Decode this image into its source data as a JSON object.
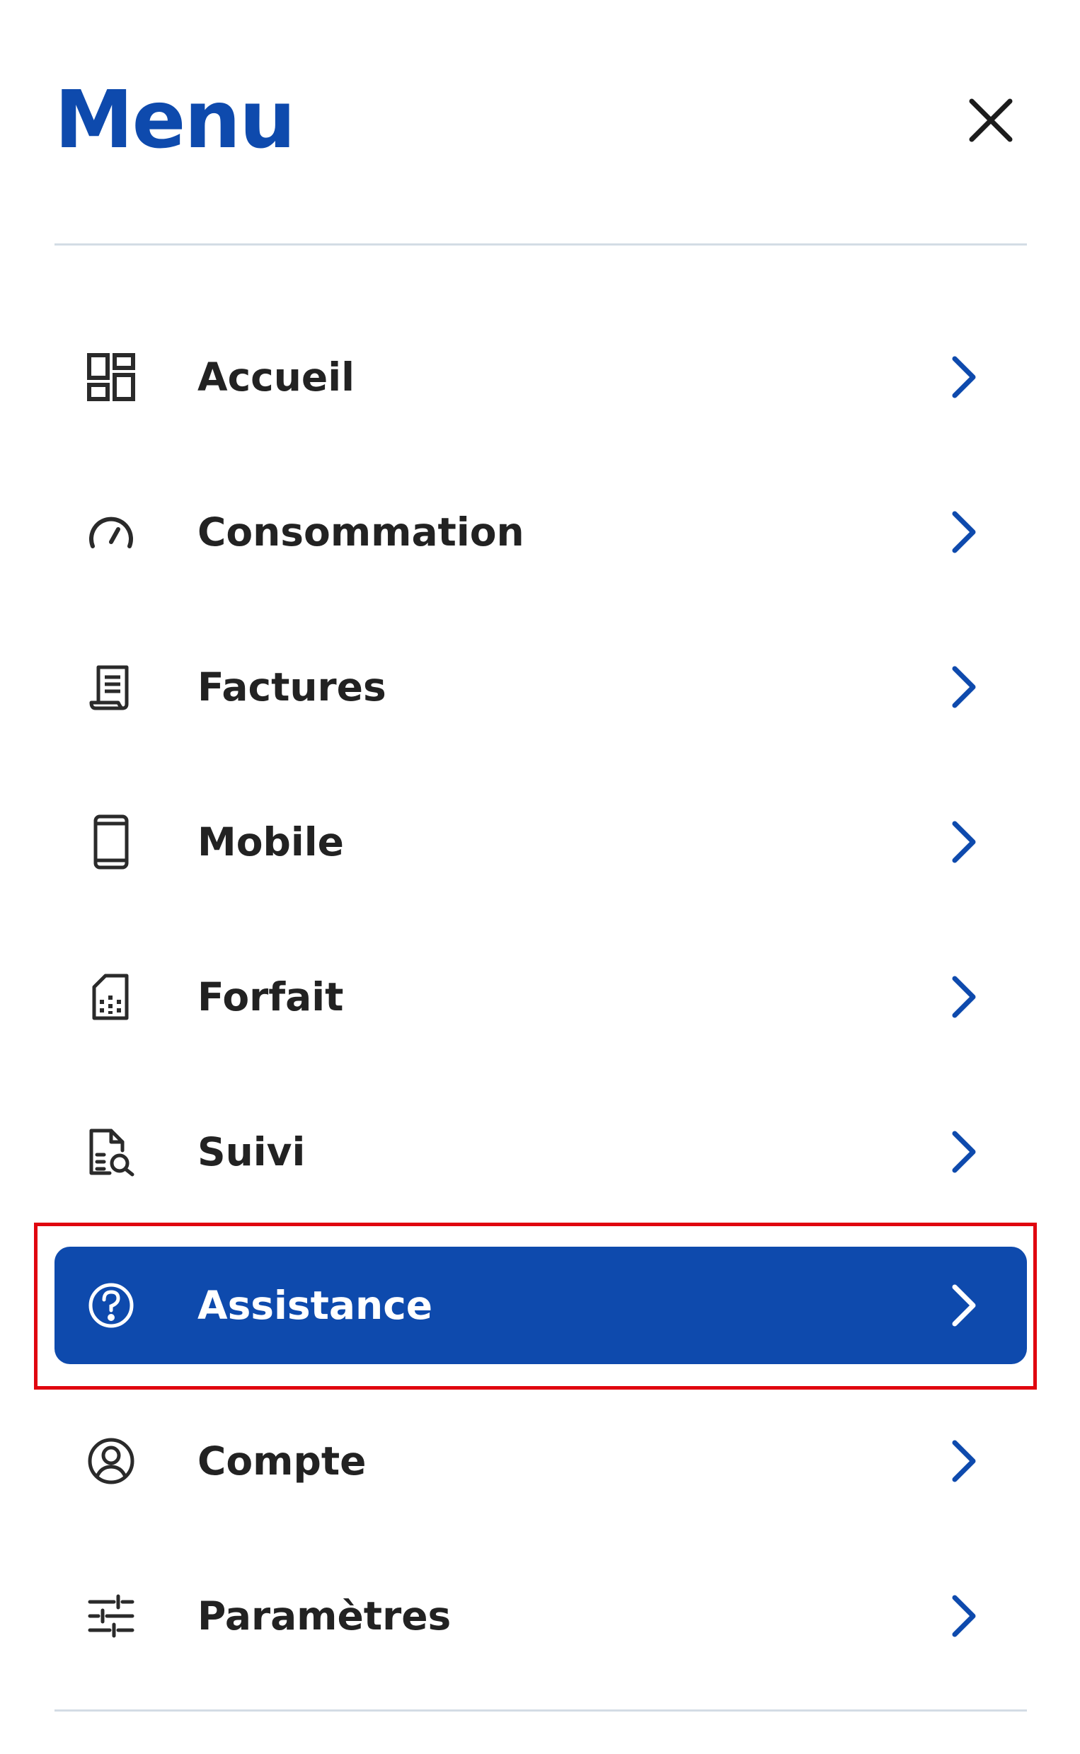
{
  "header": {
    "title": "Menu",
    "close_icon": "close-icon"
  },
  "menu": {
    "items": [
      {
        "label": "Accueil",
        "icon": "dashboard-icon"
      },
      {
        "label": "Consommation",
        "icon": "gauge-icon"
      },
      {
        "label": "Factures",
        "icon": "receipt-icon"
      },
      {
        "label": "Mobile",
        "icon": "smartphone-icon"
      },
      {
        "label": "Forfait",
        "icon": "sim-card-icon"
      },
      {
        "label": "Suivi",
        "icon": "document-search-icon"
      },
      {
        "label": "Assistance",
        "icon": "help-circle-icon",
        "active": true
      },
      {
        "label": "Compte",
        "icon": "account-circle-icon"
      },
      {
        "label": "Paramètres",
        "icon": "sliders-icon"
      }
    ]
  },
  "colors": {
    "brand_blue": "#0E4AAD",
    "text": "#222222",
    "divider": "#D3DCE5",
    "highlight_border": "#E0050F"
  }
}
